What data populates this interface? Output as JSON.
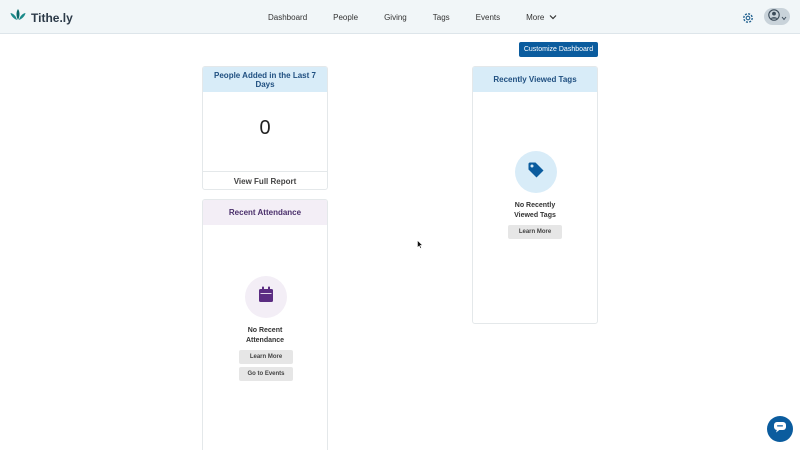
{
  "header": {
    "brand": "Tithe.ly",
    "nav": [
      {
        "label": "Dashboard"
      },
      {
        "label": "People"
      },
      {
        "label": "Giving"
      },
      {
        "label": "Tags"
      },
      {
        "label": "Events"
      },
      {
        "label": "More"
      }
    ]
  },
  "toolbar": {
    "customize_label": "Customize Dashboard"
  },
  "cards": {
    "people_added": {
      "title": "People Added in the Last 7 Days",
      "count": "0",
      "footer_link": "View Full Report"
    },
    "recent_attendance": {
      "title": "Recent Attendance",
      "empty_text": "No Recent Attendance",
      "learn_more": "Learn More",
      "go_to_events": "Go to Events"
    },
    "recently_viewed_tags": {
      "title": "Recently Viewed Tags",
      "empty_text": "No Recently Viewed Tags",
      "learn_more": "Learn More"
    }
  },
  "colors": {
    "primary": "#0b5c9e",
    "blue_header_bg": "#d8ecf8",
    "purple_header_bg": "#f3eef6",
    "attendance_icon": "#5b2d82",
    "tag_icon": "#0b5c9e"
  },
  "icons": {
    "logo": "leaf-logo-icon",
    "more": "chevron-down-icon",
    "settings": "gear-icon",
    "user": "user-avatar-icon",
    "attendance": "calendar-icon",
    "tags": "tag-icon",
    "chat": "chat-icon"
  }
}
